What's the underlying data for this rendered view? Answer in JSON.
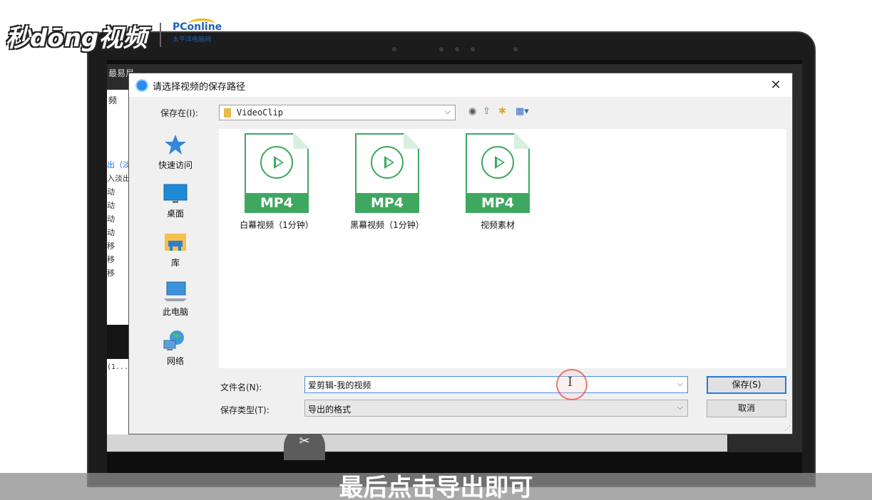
{
  "watermark": {
    "brand": "秒dōng视频",
    "partner": "PConline",
    "partner_sub": "太平洋电脑网"
  },
  "background_app": {
    "title_fragment": "最易尼",
    "tab_fragment": "频",
    "list_fragments": [
      "出（淡",
      "入淡出",
      "动",
      "动",
      "动",
      "动",
      "移",
      "移",
      "移"
    ],
    "code_fragment": "(1..."
  },
  "dialog": {
    "title": "请选择视频的保存路径",
    "close_icon": "✕",
    "save_in_label": "保存在(I):",
    "path": "VideoClip",
    "places": [
      {
        "label": "快速访问",
        "icon": "star-icon"
      },
      {
        "label": "桌面",
        "icon": "desktop-icon"
      },
      {
        "label": "库",
        "icon": "library-icon"
      },
      {
        "label": "此电脑",
        "icon": "computer-icon"
      },
      {
        "label": "网络",
        "icon": "network-icon"
      }
    ],
    "files": [
      {
        "badge": "MP4",
        "name": "白幕视频（1分钟）"
      },
      {
        "badge": "MP4",
        "name": "黑幕视频（1分钟）"
      },
      {
        "badge": "MP4",
        "name": "视频素材"
      }
    ],
    "filename_label": "文件名(N):",
    "filename_value": "爱剪辑-我的视频",
    "filetype_label": "保存类型(T):",
    "filetype_value": "导出的格式",
    "save_button": "保存(S)",
    "cancel_button": "取消"
  },
  "caption": "最后点击导出即可",
  "colors": {
    "mp4_green": "#3ea860",
    "focus_blue": "#2a7bd4"
  }
}
